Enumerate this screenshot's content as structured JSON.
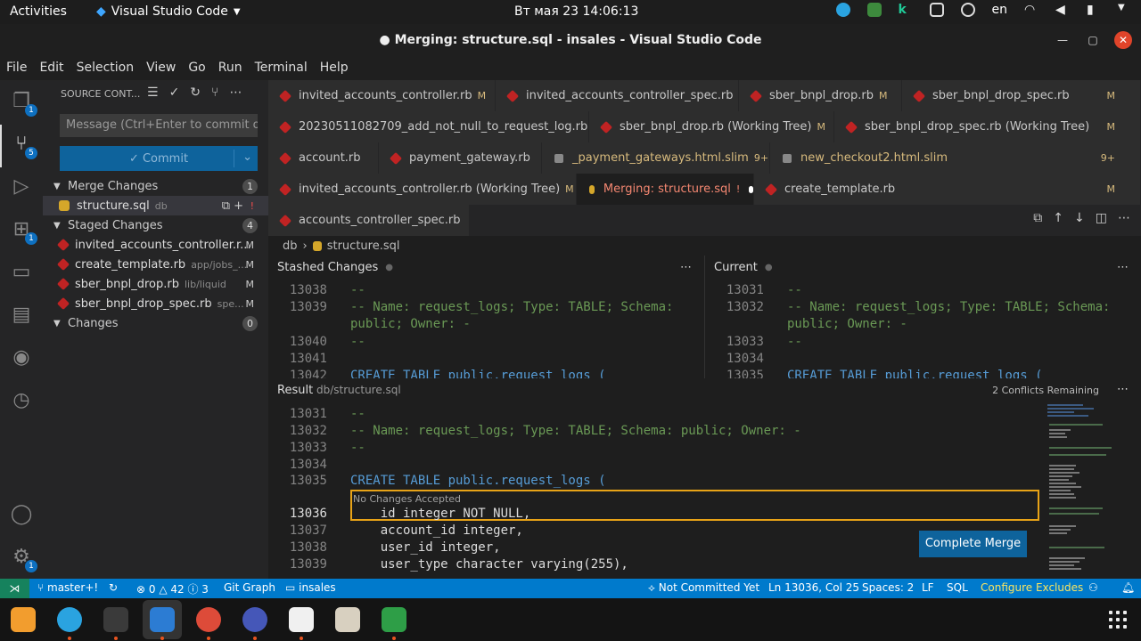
{
  "system": {
    "activities": "Activities",
    "app_name": "Visual Studio Code",
    "clock": "Вт мая 23  14:06:13",
    "lang": "en"
  },
  "window": {
    "title": "● Merging: structure.sql - insales - Visual Studio Code"
  },
  "menu": [
    "File",
    "Edit",
    "Selection",
    "View",
    "Go",
    "Run",
    "Terminal",
    "Help"
  ],
  "activity_bar": {
    "badges": {
      "explorer": "1",
      "scm": "5",
      "extensions": "1",
      "settings": "1"
    }
  },
  "sidebar": {
    "title": "SOURCE CONT...",
    "message_placeholder": "Message (Ctrl+Enter to commit o...",
    "commit_label": "✓ Commit",
    "merge_changes": {
      "label": "Merge Changes",
      "count": "1"
    },
    "merge_files": [
      {
        "name": "structure.sql",
        "path": "db",
        "status": "!"
      }
    ],
    "staged_changes": {
      "label": "Staged Changes",
      "count": "4"
    },
    "staged_files": [
      {
        "name": "invited_accounts_controller.r...",
        "path": "",
        "status": "M"
      },
      {
        "name": "create_template.rb",
        "path": "app/jobs_...",
        "status": "M"
      },
      {
        "name": "sber_bnpl_drop.rb",
        "path": "lib/liquid",
        "status": "M"
      },
      {
        "name": "sber_bnpl_drop_spec.rb",
        "path": "spe...",
        "status": "M"
      }
    ],
    "changes": {
      "label": "Changes",
      "count": "0"
    }
  },
  "tabs": {
    "row1": [
      {
        "label": "invited_accounts_controller.rb",
        "mark": "M"
      },
      {
        "label": "invited_accounts_controller_spec.rb",
        "mark": ""
      },
      {
        "label": "sber_bnpl_drop.rb",
        "mark": "M"
      },
      {
        "label": "sber_bnpl_drop_spec.rb",
        "mark": "M"
      }
    ],
    "row2": [
      {
        "label": "20230511082709_add_not_null_to_request_log.rb",
        "mark": ""
      },
      {
        "label": "sber_bnpl_drop.rb (Working Tree)",
        "mark": "M"
      },
      {
        "label": "sber_bnpl_drop_spec.rb (Working Tree)",
        "mark": "M"
      }
    ],
    "row3": [
      {
        "label": "account.rb",
        "mark": ""
      },
      {
        "label": "payment_gateway.rb",
        "mark": ""
      },
      {
        "label": "_payment_gateways.html.slim",
        "mark": "9+"
      },
      {
        "label": "new_checkout2.html.slim",
        "mark": "9+"
      }
    ],
    "row4": [
      {
        "label": "invited_accounts_controller.rb (Working Tree)",
        "mark": "M"
      },
      {
        "label": "Merging: structure.sql",
        "mark": "!"
      },
      {
        "label": "create_template.rb",
        "mark": "M"
      }
    ],
    "row5": [
      {
        "label": "accounts_controller_spec.rb",
        "mark": ""
      }
    ]
  },
  "breadcrumb": {
    "folder": "db",
    "file": "structure.sql"
  },
  "stashed": {
    "title": "Stashed Changes",
    "lines": [
      {
        "n": "13038",
        "t": "--"
      },
      {
        "n": "13039",
        "t": "-- Name: request_logs; Type: TABLE; Schema:"
      },
      {
        "n": "",
        "t": "public; Owner: -"
      },
      {
        "n": "13040",
        "t": "--"
      },
      {
        "n": "13041",
        "t": ""
      },
      {
        "n": "13042",
        "t": "CREATE TABLE public.request_logs ("
      }
    ]
  },
  "current": {
    "title": "Current",
    "lines": [
      {
        "n": "13031",
        "t": "--"
      },
      {
        "n": "13032",
        "t": "-- Name: request_logs; Type: TABLE; Schema:"
      },
      {
        "n": "",
        "t": "public; Owner: -"
      },
      {
        "n": "13033",
        "t": "--"
      },
      {
        "n": "13034",
        "t": ""
      },
      {
        "n": "13035",
        "t": "CREATE TABLE public.request_logs ("
      }
    ]
  },
  "result": {
    "title": "Result",
    "path": "db/structure.sql",
    "conflicts": "2 Conflicts Remaining",
    "no_changes": "No Changes Accepted",
    "complete_merge": "Complete Merge",
    "lines": [
      {
        "n": "13031",
        "t": "--"
      },
      {
        "n": "13032",
        "t": "-- Name: request_logs; Type: TABLE; Schema: public; Owner: -"
      },
      {
        "n": "13033",
        "t": "--"
      },
      {
        "n": "13034",
        "t": ""
      },
      {
        "n": "13035",
        "t": "CREATE TABLE public.request_logs ("
      },
      {
        "n": "13036",
        "t": "    id integer NOT NULL,"
      },
      {
        "n": "13037",
        "t": "    account_id integer,"
      },
      {
        "n": "13038",
        "t": "    user_id integer,"
      },
      {
        "n": "13039",
        "t": "    user_type character varying(255),"
      }
    ]
  },
  "status": {
    "branch": "master+!",
    "problems": "⊗ 0 △ 42 ⓘ 3",
    "git_graph": "Git Graph",
    "folder": "insales",
    "commit_state": "Not Committed Yet",
    "position": "Ln 13036, Col 25",
    "spaces": "Spaces: 2",
    "eol": "LF",
    "language": "SQL",
    "configure": "Configure Excludes"
  },
  "colors": {
    "accent": "#007acc",
    "conflict": "#e8a317",
    "ruby": "#c02323"
  }
}
